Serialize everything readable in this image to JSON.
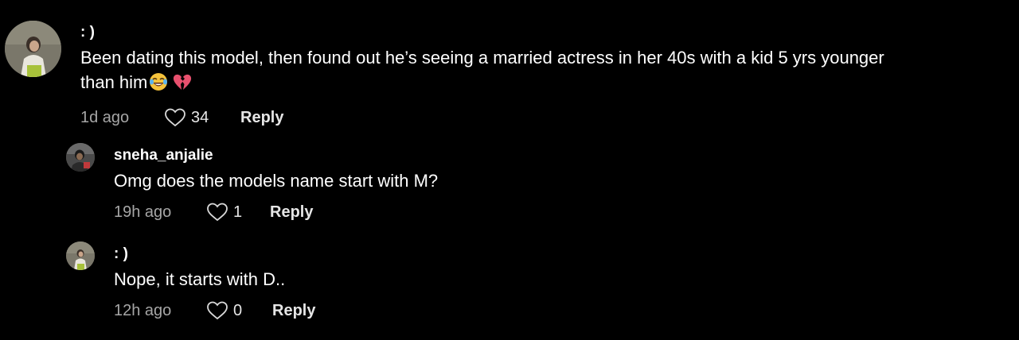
{
  "colors": {
    "background": "#000000",
    "text": "#ffffff",
    "meta": "#a6a6a6",
    "heart_outline": "#d9d9d9",
    "broken_heart": "#e8506e",
    "laugh_emoji": "#f5c33b"
  },
  "comments": [
    {
      "username": ": )",
      "text": "Been dating this model, then found out he’s seeing a married actress in her 40s with a kid 5 yrs younger",
      "text_line2": "than him",
      "emojis": [
        "face-with-tears-of-joy-icon",
        "broken-heart-icon"
      ],
      "time": "1d ago",
      "likes": "34",
      "reply_label": "Reply",
      "avatar_icon": "user-avatar-photo"
    },
    {
      "username": "sneha_anjalie",
      "text": "Omg does the models name start with M?",
      "time": "19h ago",
      "likes": "1",
      "reply_label": "Reply",
      "avatar_icon": "user-avatar-photo"
    },
    {
      "username": ": )",
      "text": "Nope, it starts with D..",
      "time": "12h ago",
      "likes": "0",
      "reply_label": "Reply",
      "avatar_icon": "user-avatar-photo"
    }
  ]
}
